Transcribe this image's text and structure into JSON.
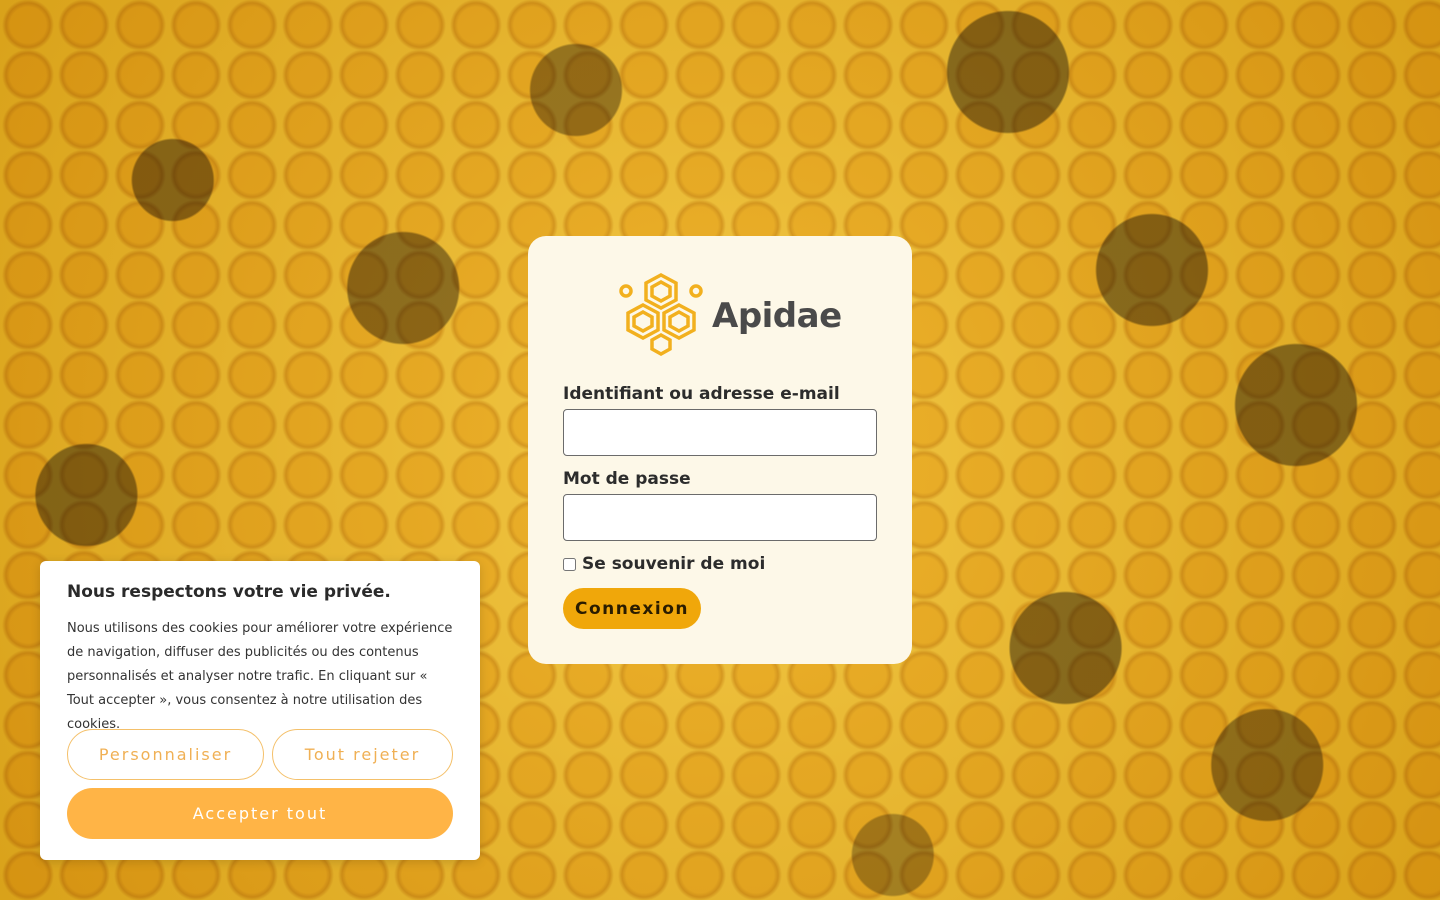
{
  "brand": {
    "name": "Apidae",
    "logo_icon": "honeycomb-logo-icon",
    "accent_color": "#f0a70a"
  },
  "login": {
    "username_label": "Identifiant ou adresse e-mail",
    "username_value": "",
    "password_label": "Mot de passe",
    "password_value": "",
    "remember_label": "Se souvenir de moi",
    "remember_checked": false,
    "submit_label": "Connexion"
  },
  "cookie_banner": {
    "title": "Nous respectons votre vie privée.",
    "text": "Nous utilisons des cookies pour améliorer votre expérience de navigation, diffuser des publicités ou des contenus personnalisés et analyser notre trafic. En cliquant sur « Tout accepter », vous consentez à notre utilisation des cookies.",
    "customize_label": "Personnaliser",
    "reject_label": "Tout rejeter",
    "accept_label": "Accepter tout"
  }
}
